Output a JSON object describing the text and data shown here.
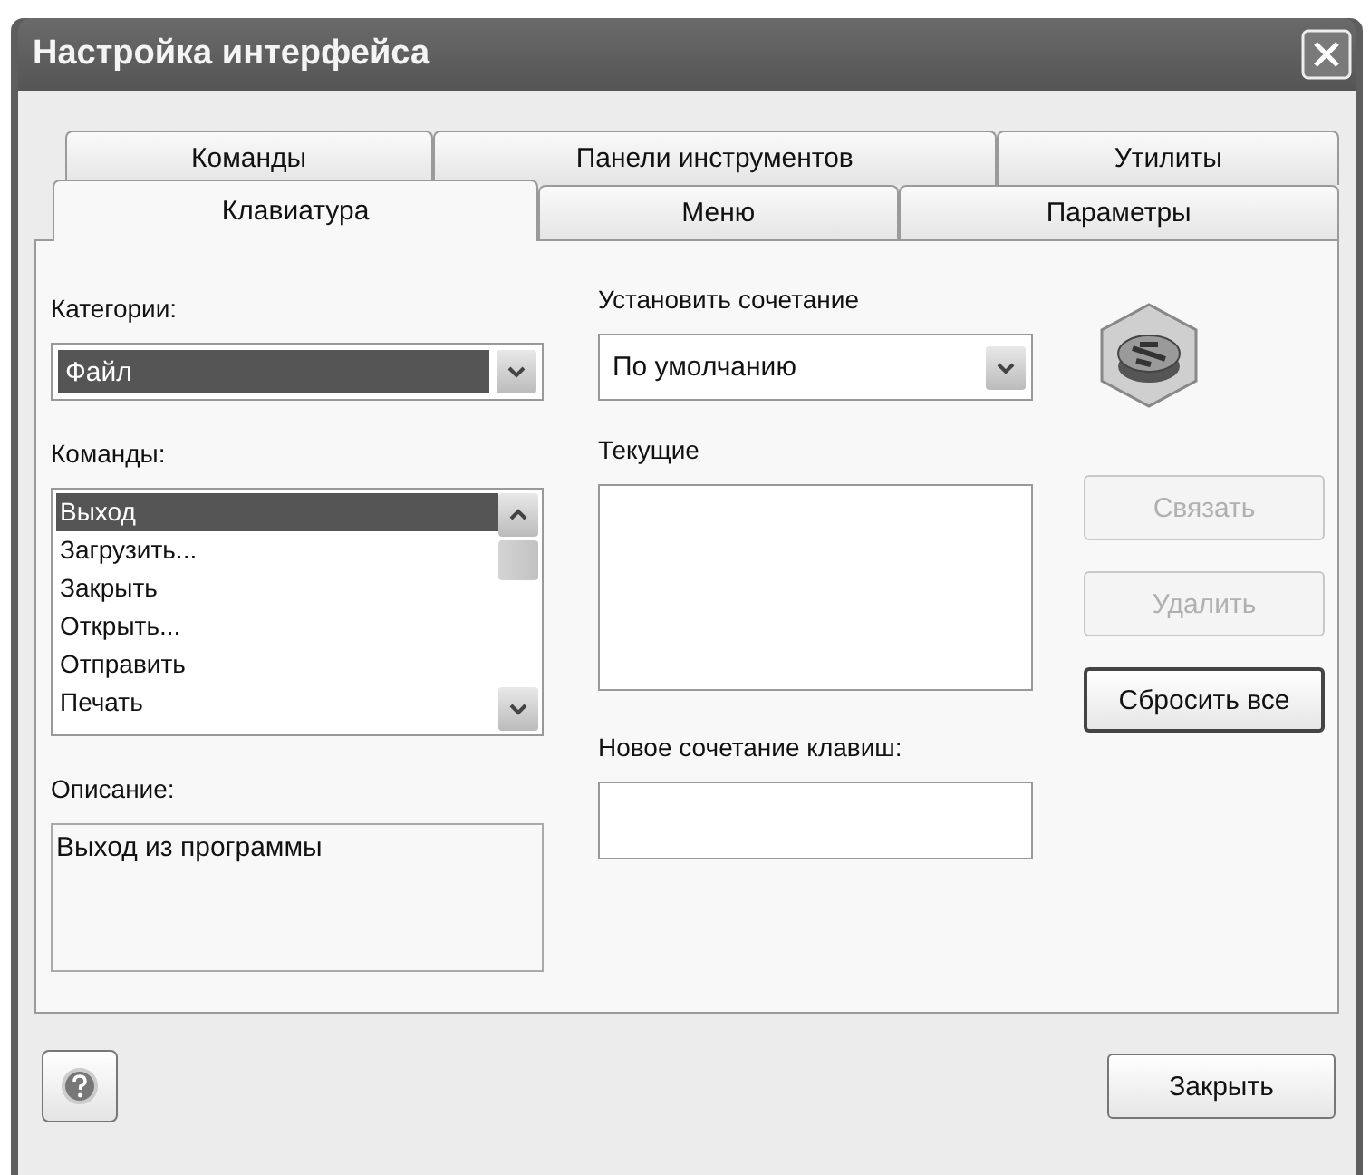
{
  "window": {
    "title": "Настройка интерфейса"
  },
  "tab_rows": [
    [
      {
        "label": "Команды",
        "selected": false
      },
      {
        "label": "Панели инструментов",
        "selected": false
      },
      {
        "label": "Утилиты",
        "selected": false
      }
    ],
    [
      {
        "label": "Клавиатура",
        "selected": true
      },
      {
        "label": "Меню",
        "selected": false
      },
      {
        "label": "Параметры",
        "selected": false
      }
    ]
  ],
  "categories": {
    "label": "Категории:",
    "value": "Файл"
  },
  "commands": {
    "label": "Команды:",
    "items": [
      {
        "label": "Выход",
        "selected": true
      },
      {
        "label": "Загрузить...",
        "selected": false
      },
      {
        "label": "Закрыть",
        "selected": false
      },
      {
        "label": "Открыть...",
        "selected": false
      },
      {
        "label": "Отправить",
        "selected": false
      },
      {
        "label": "Печать",
        "selected": false
      }
    ]
  },
  "description": {
    "label": "Описание:",
    "value": "Выход из программы"
  },
  "shortcut_set": {
    "label": "Установить сочетание",
    "value": "По умолчанию"
  },
  "current": {
    "label": "Текущие"
  },
  "new_shortcut": {
    "label": "Новое сочетание клавиш:"
  },
  "side_buttons": [
    {
      "label": "Связать",
      "disabled": true
    },
    {
      "label": "Удалить",
      "disabled": true
    },
    {
      "label": "Сбросить все",
      "disabled": false
    }
  ],
  "close_button": {
    "label": "Закрыть"
  }
}
